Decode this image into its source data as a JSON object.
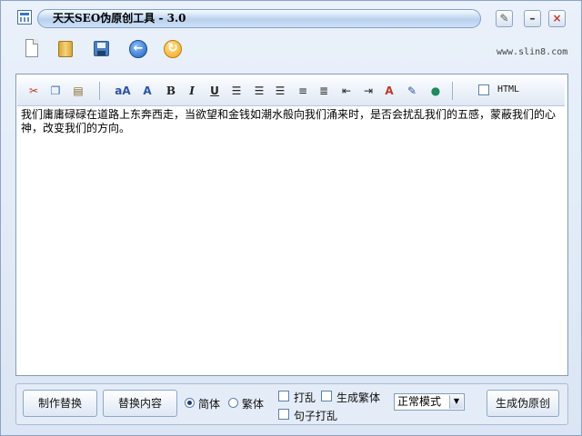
{
  "window": {
    "title": "天天SEO伪原创工具 - 3.0",
    "controls": {
      "skin": "✎",
      "minimize": "–",
      "close": "×"
    }
  },
  "toolbar": {
    "icons": [
      "new-file-icon",
      "open-folder-icon",
      "save-icon",
      "back-icon",
      "redo-icon"
    ],
    "site_url": "www.slin8.com"
  },
  "format_toolbar": {
    "buttons": [
      "cut-icon",
      "copy-icon",
      "paste-icon",
      "find-replace-icon",
      "font-size-icon",
      "bold-icon",
      "italic-icon",
      "underline-icon",
      "align-left-icon",
      "align-center-icon",
      "align-right-icon",
      "ordered-list-icon",
      "unordered-list-icon",
      "outdent-icon",
      "indent-icon",
      "font-color-icon",
      "highlight-icon",
      "link-globe-icon"
    ],
    "html_label": "HTML",
    "html_checked": false
  },
  "editor": {
    "content": "我们庸庸碌碌在道路上东奔西走，当欲望和金钱如潮水般向我们涌来时，是否会扰乱我们的五感，蒙蔽我们的心神，改变我们的方向。"
  },
  "bottom": {
    "make_replace_label": "制作替换",
    "replace_content_label": "替换内容",
    "radio_simplified_label": "简体",
    "radio_traditional_label": "繁体",
    "radio_selected": "simplified",
    "shuffle_label": "打乱",
    "generate_traditional_label": "生成繁体",
    "sentence_shuffle_label": "句子打乱",
    "mode_select_value": "正常模式",
    "generate_button_label": "生成伪原创"
  }
}
